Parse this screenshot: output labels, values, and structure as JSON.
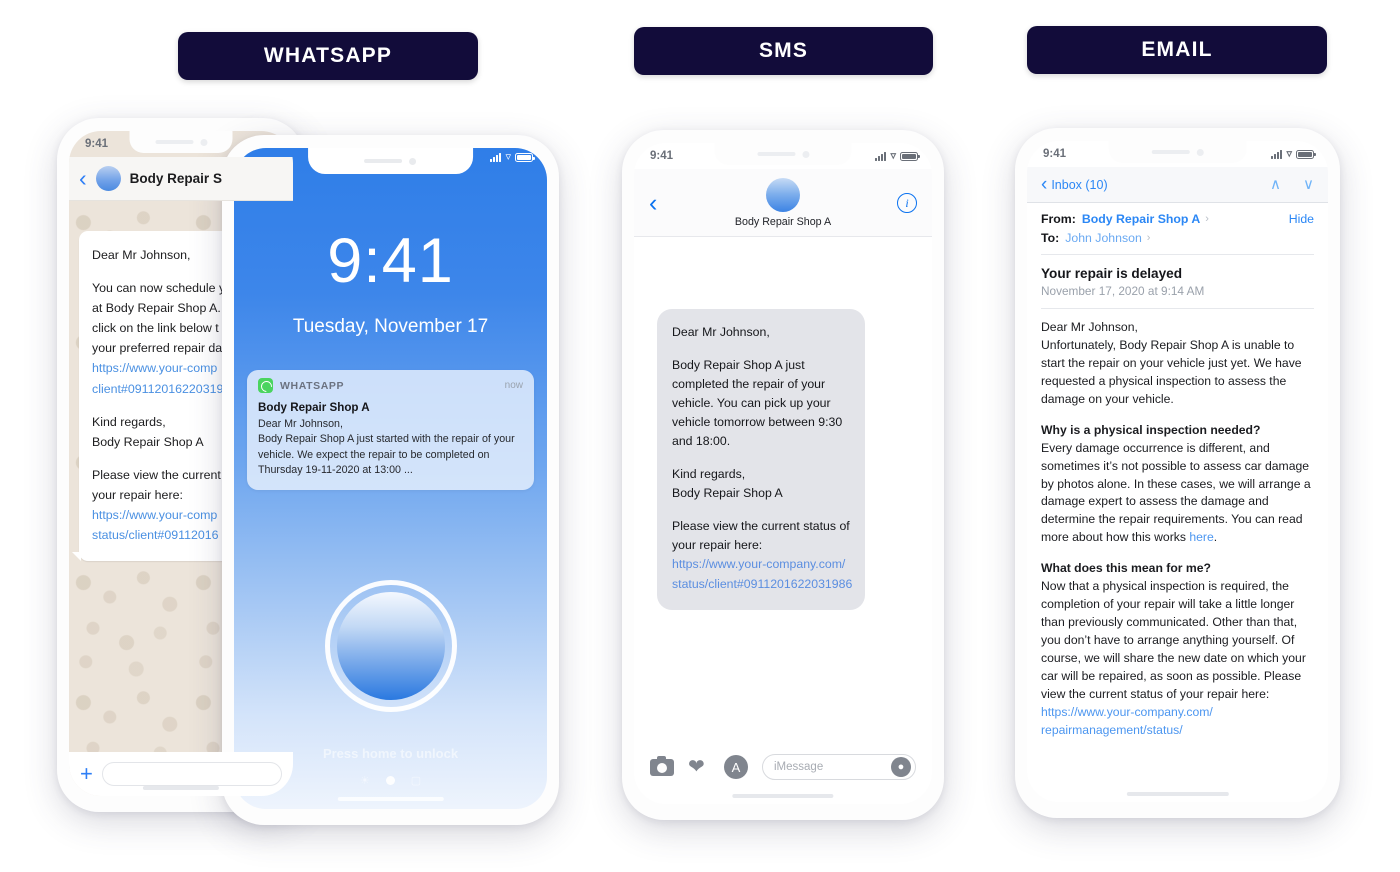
{
  "headers": {
    "whatsapp": "WHATSAPP",
    "sms": "SMS",
    "email": "EMAIL",
    "badge_color": "#120c3a"
  },
  "whatsapp_phone": {
    "status_time": "9:41",
    "contact_name": "Body Repair S",
    "back_icon": "chevron-left-icon",
    "message": {
      "greeting": "Dear Mr Johnson,",
      "paragraph1": "You can now schedule y\nat Body Repair Shop A.\nclick on the link below t\nyour preferred repair da",
      "link1": "https://www.your-comp\nclient#09112016220319",
      "signoff": "Kind regards,\nBody Repair Shop A",
      "paragraph2": "Please view the current\nyour repair here:",
      "link2": "https://www.your-comp\nstatus/client#09112016"
    },
    "input_placeholder": "",
    "plus_icon": "plus-icon"
  },
  "lock_phone": {
    "clock": "9:41",
    "date": "Tuesday, November 17",
    "unlock_hint": "Press home to unlock",
    "notification": {
      "app": "WHATSAPP",
      "time": "now",
      "title": "Body Repair Shop A",
      "body": "Dear Mr Johnson,\nBody Repair Shop A just started with the repair of your vehicle. We expect the repair to be completed on Thursday 19-11-2020 at 13:00 ..."
    }
  },
  "sms_phone": {
    "status_time": "9:41",
    "contact_name": "Body Repair Shop A",
    "back_icon": "chevron-left-icon",
    "info_icon": "info-icon",
    "message": {
      "greeting": "Dear Mr Johnson,",
      "paragraph1": "Body Repair Shop A just completed the repair of your vehicle. You can pick up your vehicle tomorrow between 9:30 and 18:00.",
      "signoff": "Kind regards,\nBody Repair Shop A",
      "paragraph2": "Please view the current status of\nyour repair here:",
      "link": "https://www.your-company.com/\nstatus/client#0911201622031986"
    },
    "input_placeholder": "iMessage",
    "toolbar_icons": [
      "camera-icon",
      "digital-touch-icon",
      "app-store-icon",
      "microphone-icon"
    ]
  },
  "email_phone": {
    "status_time": "9:41",
    "inbox_label": "Inbox (10)",
    "back_icon": "chevron-left-icon",
    "up_icon": "chevron-up-icon",
    "down_icon": "chevron-down-icon",
    "from_label": "From:",
    "from_value": "Body Repair Shop A",
    "to_label": "To:",
    "to_value": "John Johnson",
    "hide_label": "Hide",
    "subject": "Your repair is delayed",
    "date": "November 17, 2020 at 9:14 AM",
    "body": {
      "intro": "Dear Mr Johnson,\nUnfortunately, Body Repair Shop A is unable to start the repair on your vehicle just yet. We have requested a physical inspection to assess the damage on your vehicle.",
      "heading1": "Why is a physical inspection needed?",
      "para1_before": "Every damage occurrence is different, and sometimes it’s not possible to assess car damage by photos alone. In these cases, we will arrange a damage expert to assess the damage and determine the repair requirements. You can read more about how this works ",
      "para1_link": "here",
      "para1_after": ".",
      "heading2": "What does this mean for me?",
      "para2_before": "Now that a physical inspection is required, the completion of your repair will take a little longer than previously communicated. Other than that, you don’t have to arrange anything yourself. Of course, we will share the new date on which your car will be repaired, as soon as possible. Please view the current status of your repair here: ",
      "para2_link": "https://www.your-company.com/\nrepairmanagement/status/"
    }
  }
}
